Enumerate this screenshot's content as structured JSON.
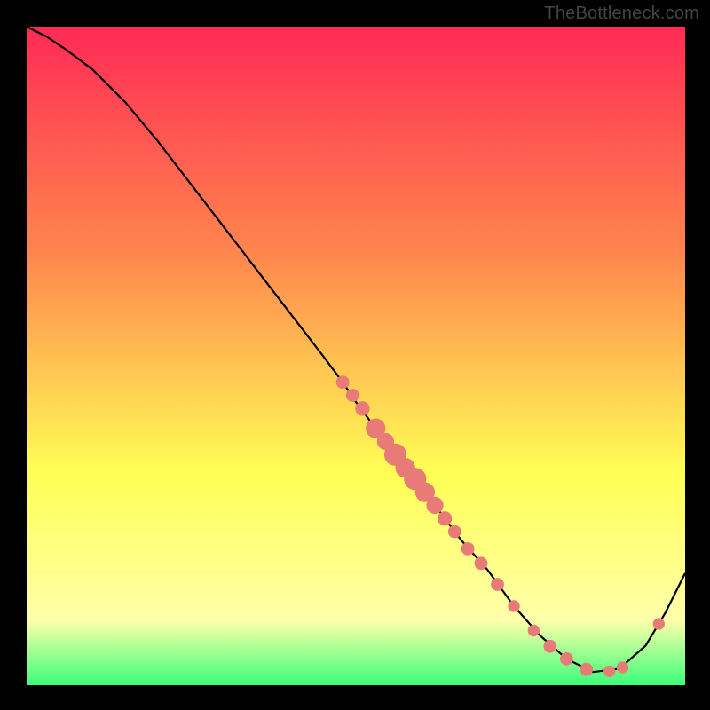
{
  "watermark": "TheBottleneck.com",
  "chart_data": {
    "type": "line",
    "title": "",
    "xlabel": "",
    "ylabel": "",
    "xlim": [
      0,
      100
    ],
    "ylim": [
      0,
      100
    ],
    "gradient_bg": {
      "top": "#ff2a55",
      "mid1": "#ff884d",
      "mid2": "#ffff55",
      "mid3": "#ffffaa",
      "bottom": "#3cff7a"
    },
    "series": [
      {
        "name": "bottleneck-curve",
        "x": [
          0,
          3,
          6,
          10,
          15,
          20,
          25,
          30,
          35,
          40,
          45,
          48,
          50,
          53,
          56,
          60,
          63,
          66,
          70,
          74,
          78,
          82,
          86,
          90,
          94,
          97,
          100
        ],
        "y": [
          100,
          98.5,
          96.5,
          93.5,
          88.5,
          82.5,
          76,
          69.5,
          63,
          56.5,
          50,
          46,
          43,
          39,
          35,
          30,
          26,
          22,
          17.5,
          12,
          7.5,
          4,
          2,
          2.5,
          6,
          11,
          17
        ]
      }
    ],
    "markers": {
      "name": "highlight-points",
      "color": "#e87a77",
      "points": [
        {
          "x": 48,
          "y": 46,
          "r": 1.0
        },
        {
          "x": 49.5,
          "y": 44,
          "r": 1.0
        },
        {
          "x": 51,
          "y": 42,
          "r": 1.1
        },
        {
          "x": 53,
          "y": 39,
          "r": 1.5
        },
        {
          "x": 54.5,
          "y": 37,
          "r": 1.3
        },
        {
          "x": 56,
          "y": 35,
          "r": 1.7
        },
        {
          "x": 57.5,
          "y": 33,
          "r": 1.5
        },
        {
          "x": 59,
          "y": 31.3,
          "r": 1.7
        },
        {
          "x": 60.5,
          "y": 29.3,
          "r": 1.5
        },
        {
          "x": 62,
          "y": 27.3,
          "r": 1.3
        },
        {
          "x": 63.5,
          "y": 25.3,
          "r": 1.1
        },
        {
          "x": 65,
          "y": 23.3,
          "r": 1.0
        },
        {
          "x": 67,
          "y": 20.7,
          "r": 1.0
        },
        {
          "x": 69,
          "y": 18.5,
          "r": 1.0
        },
        {
          "x": 71.5,
          "y": 15.3,
          "r": 1.0
        },
        {
          "x": 74,
          "y": 12,
          "r": 0.9
        },
        {
          "x": 77,
          "y": 8.3,
          "r": 0.9
        },
        {
          "x": 79.5,
          "y": 5.9,
          "r": 1.0
        },
        {
          "x": 82,
          "y": 4.0,
          "r": 1.0
        },
        {
          "x": 85,
          "y": 2.4,
          "r": 1.0
        },
        {
          "x": 88.5,
          "y": 2.1,
          "r": 0.9
        },
        {
          "x": 90.5,
          "y": 2.7,
          "r": 0.9
        },
        {
          "x": 96,
          "y": 9.3,
          "r": 0.9
        }
      ]
    }
  }
}
